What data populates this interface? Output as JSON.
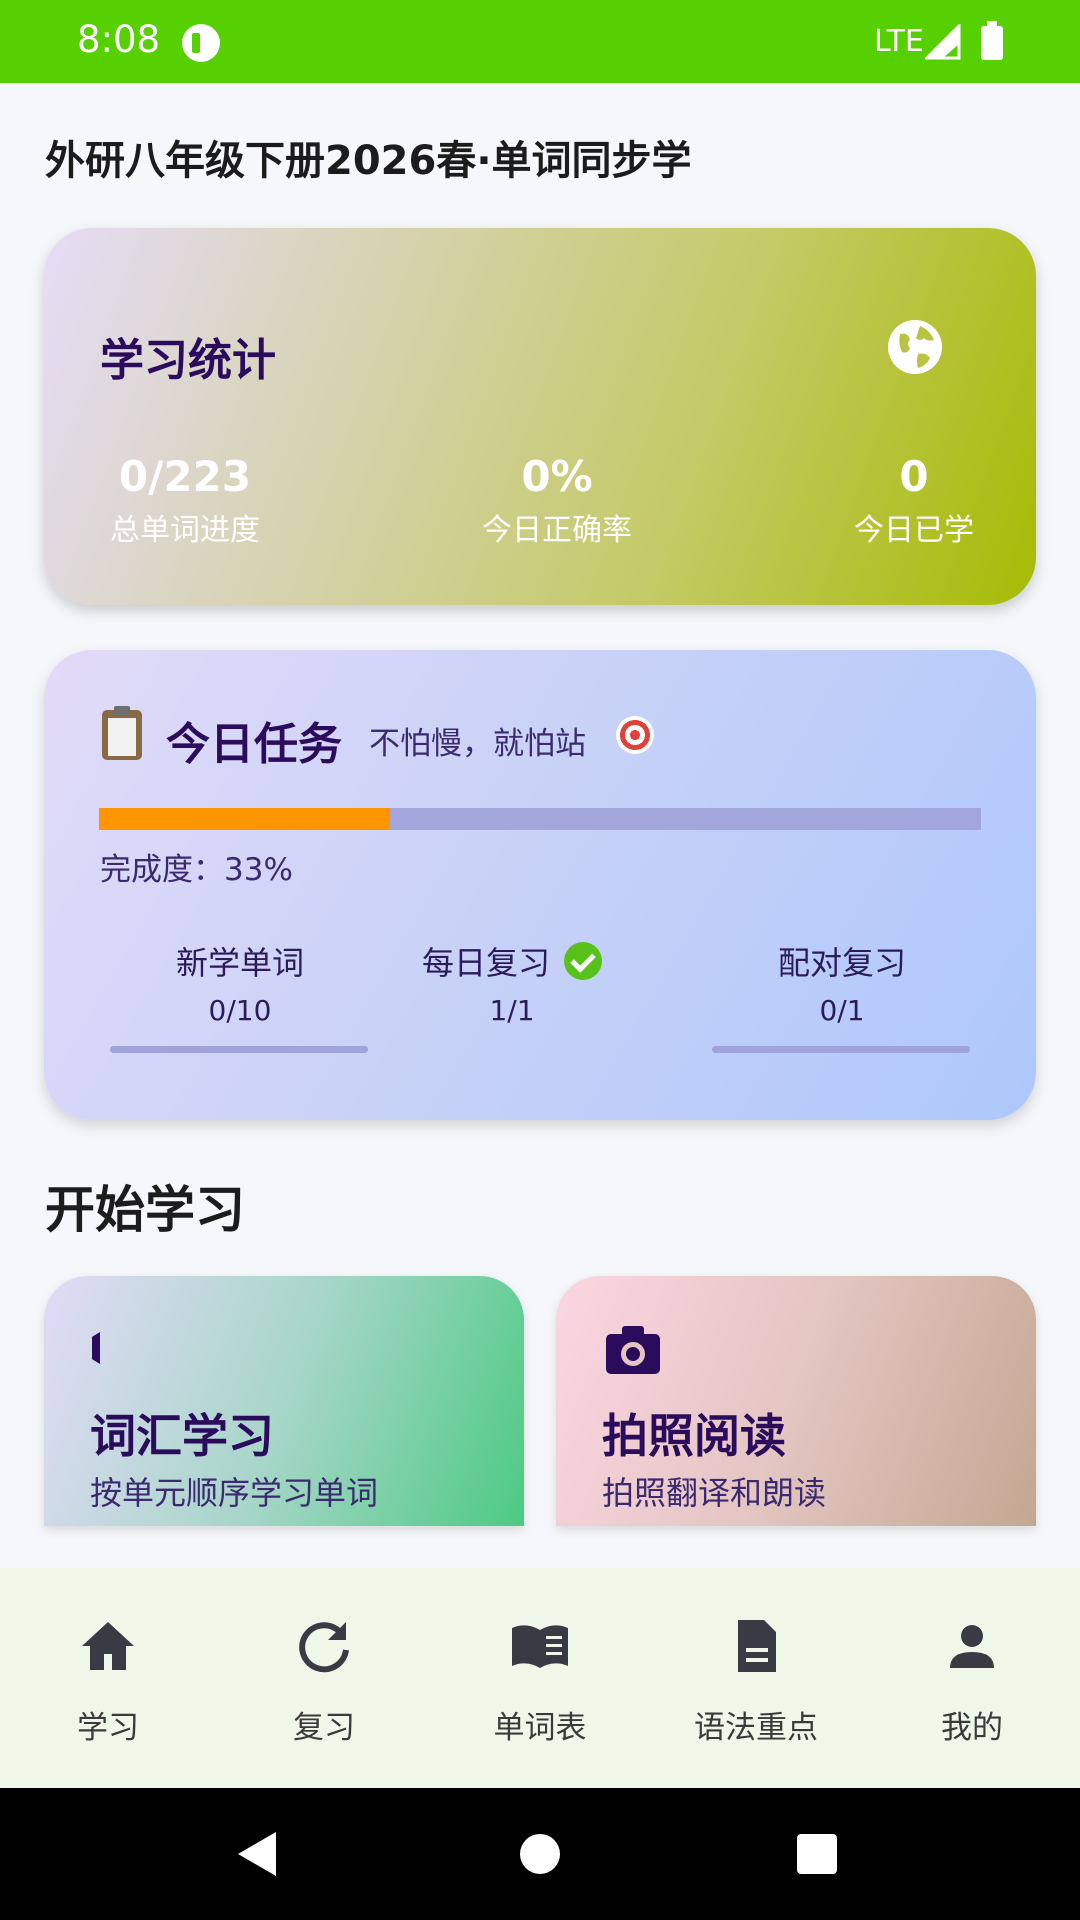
{
  "status_bar": {
    "time": "8:08",
    "network": "LTE"
  },
  "page": {
    "title": "外研八年级下册2026春·单词同步学"
  },
  "stats_card": {
    "title": "学习统计",
    "stats": [
      {
        "value": "0/223",
        "label": "总单词进度"
      },
      {
        "value": "0%",
        "label": "今日正确率"
      },
      {
        "value": "0",
        "label": "今日已学"
      }
    ]
  },
  "task_card": {
    "title": "今日任务",
    "motto": "不怕慢，就怕站",
    "progress_percent": 33,
    "completion_text": "完成度：33%",
    "subtasks": [
      {
        "name": "新学单词",
        "count": "0/10",
        "done": false
      },
      {
        "name": "每日复习",
        "count": "1/1",
        "done": true
      },
      {
        "name": "配对复习",
        "count": "0/1",
        "done": false
      }
    ]
  },
  "section": {
    "title": "开始学习"
  },
  "actions": {
    "vocab": {
      "title": "词汇学习",
      "subtitle": "按单元顺序学习单词",
      "icon": "play-icon"
    },
    "photo": {
      "title": "拍照阅读",
      "subtitle": "拍照翻译和朗读",
      "icon": "camera-icon"
    }
  },
  "bottom_nav": {
    "items": [
      {
        "label": "学习",
        "icon": "home-icon"
      },
      {
        "label": "复习",
        "icon": "refresh-icon"
      },
      {
        "label": "单词表",
        "icon": "book-icon"
      },
      {
        "label": "语法重点",
        "icon": "document-icon"
      },
      {
        "label": "我的",
        "icon": "person-icon"
      }
    ]
  },
  "colors": {
    "status_bar": "#56d000",
    "progress_fill": "#ff9500",
    "progress_track": "#a3a6db",
    "title_purple": "#2b0b5c",
    "nav_background": "#eff8e8"
  }
}
